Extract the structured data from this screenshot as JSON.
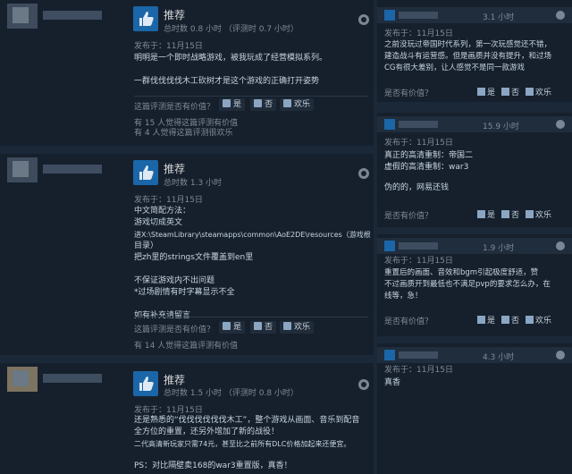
{
  "reviews": [
    {
      "recommend_label": "推荐",
      "playtime": "总时数 0.8 小时 （评测时 0.7 小时）",
      "date": "发布于：11月15日",
      "lines": [
        "明明是一个即时战略游戏，被我玩成了经营模拟系列。",
        "",
        "一群伐伐伐伐木工砍树才是这个游戏的正确打开姿势"
      ],
      "helpful_question": "这篇评测是否有价值？",
      "vote_yes": "是",
      "vote_no": "否",
      "vote_funny": "欢乐",
      "stats": [
        "有 15 人觉得这篇评测有价值",
        "有 4 人觉得这篇评测很欢乐"
      ]
    },
    {
      "recommend_label": "推荐",
      "playtime": "总时数 1.3 小时",
      "date": "发布于：11月15日",
      "lines": [
        "中文简配方法：",
        "游戏切成英文",
        "进X:\\SteamLibrary\\steamapps\\common\\AoE2DE\\resources（游戏根",
        "目录）",
        "把zh里的strings文件覆盖到en里",
        "",
        "不保证游戏内不出问题",
        "*过场剧情有时字幕显示不全",
        "",
        "如有补充请留言"
      ],
      "helpful_question": "这篇评测是否有价值？",
      "vote_yes": "是",
      "vote_no": "否",
      "vote_funny": "欢乐",
      "stats": [
        "有 14 人觉得这篇评测有价值"
      ]
    },
    {
      "recommend_label": "推荐",
      "playtime": "总时数 1.5 小时 （评测时 0.8 小时）",
      "date": "发布于：11月15日",
      "lines": [
        "还是熟悉的“伐伐伐伐伐伐木工”，整个游戏从画面、音乐到配音",
        "全方位的重置，还另外增加了新的战役！",
        "二代高清新玩家只需74元，甚至比之前所有DLC价格加起来还便宜。",
        "",
        "PS：对比隔壁卖168的war3重置版，真香！"
      ]
    }
  ],
  "mini_reviews": [
    {
      "playtime": "3.1 小时",
      "date": "发布于：11月15日",
      "lines": [
        "之前没玩过帝国时代系列，第一次玩感觉还不错，",
        "建造战斗有运营感。但是画质并没有提升，和过场",
        "CG有很大差别，让人感觉不是同一款游戏"
      ],
      "question": "是否有价值？",
      "vote_yes": "是",
      "vote_no": "否",
      "vote_funny": "欢乐"
    },
    {
      "playtime": "15.9 小时",
      "date": "发布于：11月15日",
      "lines": [
        "真正的高清重制：帝国二",
        "虚假的高清重制：war3",
        "",
        "伪的的，网易还钱"
      ],
      "question": "是否有价值？",
      "vote_yes": "是",
      "vote_no": "否",
      "vote_funny": "欢乐"
    },
    {
      "playtime": "1.9 小时",
      "date": "发布于：11月15日",
      "lines": [
        "重置后的画面、音效和bgm引起极度舒适，赞",
        "不过画质开到最低也不满足pvp的要求怎么办，在",
        "线等，急！"
      ],
      "question": "是否有价值？",
      "vote_yes": "是",
      "vote_no": "否",
      "vote_funny": "欢乐"
    },
    {
      "playtime": "4.3 小时",
      "date": "发布于：11月15日",
      "lines": [
        "真香"
      ]
    }
  ],
  "colors": {
    "background": "#1b2838",
    "panel": "#16202d",
    "header": "#202d3d",
    "thumb": "#1a66a8",
    "text": "#c6d4df",
    "muted": "#7e8a96"
  },
  "icons": [
    "thumbs-up-icon",
    "thumbs-down-icon",
    "funny-icon",
    "steam-icon"
  ]
}
